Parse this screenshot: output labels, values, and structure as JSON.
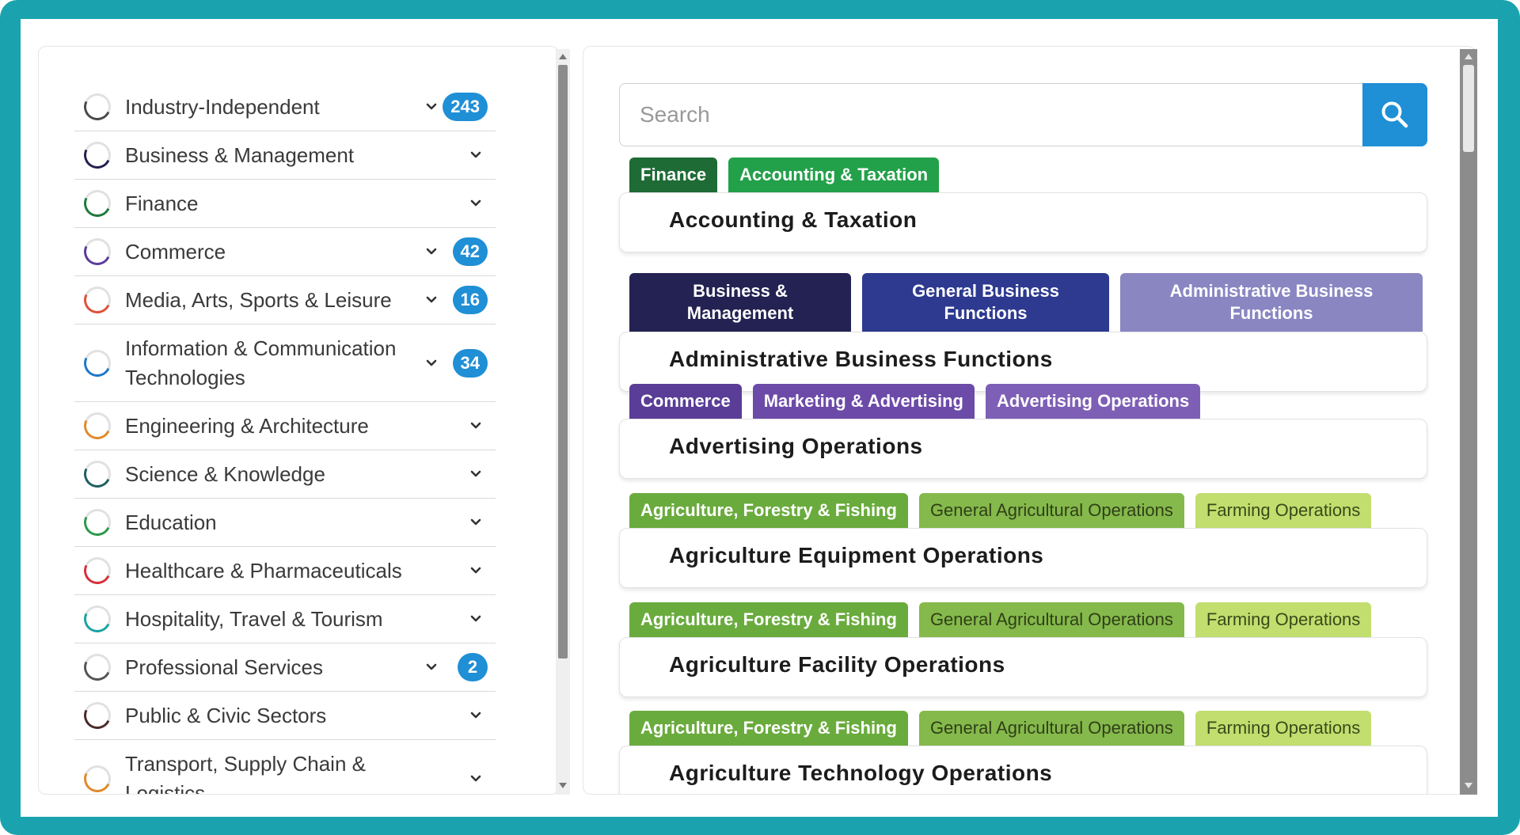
{
  "colors": {
    "frame": "#1aa3ae",
    "accent": "#1f8fd6"
  },
  "categories": [
    {
      "label": "Industry-Independent",
      "count": "243",
      "ring_color": "#4a4a4a"
    },
    {
      "label": "Business & Management",
      "count": null,
      "ring_color": "#23204f"
    },
    {
      "label": "Finance",
      "count": null,
      "ring_color": "#1e7a3c"
    },
    {
      "label": "Commerce",
      "count": "42",
      "ring_color": "#5b3c9a"
    },
    {
      "label": "Media, Arts, Sports & Leisure",
      "count": "16",
      "ring_color": "#e0503a"
    },
    {
      "label": "Information & Communication Technologies",
      "count": "34",
      "ring_color": "#1f78c8"
    },
    {
      "label": "Engineering & Architecture",
      "count": null,
      "ring_color": "#e08a2a"
    },
    {
      "label": "Science & Knowledge",
      "count": null,
      "ring_color": "#1f5f5f"
    },
    {
      "label": "Education",
      "count": null,
      "ring_color": "#2a9a4a"
    },
    {
      "label": "Healthcare & Pharmaceuticals",
      "count": null,
      "ring_color": "#d8303a"
    },
    {
      "label": "Hospitality, Travel & Tourism",
      "count": null,
      "ring_color": "#1aa3a3"
    },
    {
      "label": "Professional Services",
      "count": "2",
      "ring_color": "#555555"
    },
    {
      "label": "Public & Civic Sectors",
      "count": null,
      "ring_color": "#4a2a2a"
    },
    {
      "label": "Transport, Supply Chain & Logistics",
      "count": null,
      "ring_color": "#e08a2a"
    }
  ],
  "search": {
    "placeholder": "Search"
  },
  "results": [
    {
      "title": "Accounting & Taxation",
      "tags": [
        {
          "label": "Finance",
          "color": "#1e6b35"
        },
        {
          "label": "Accounting & Taxation",
          "color": "#23a04a"
        }
      ]
    },
    {
      "title": "Administrative Business Functions",
      "tags": [
        {
          "label": "Business & Management",
          "color": "#232252"
        },
        {
          "label": "General Business Functions",
          "color": "#2d3a8f"
        },
        {
          "label": "Administrative Business Functions",
          "color": "#8a86c2"
        }
      ]
    },
    {
      "title": "Advertising Operations",
      "tags": [
        {
          "label": "Commerce",
          "color": "#5a3d97"
        },
        {
          "label": "Marketing & Advertising",
          "color": "#6c4aa8"
        },
        {
          "label": "Advertising Operations",
          "color": "#7e5fb6"
        }
      ]
    },
    {
      "title": "Agriculture Equipment Operations",
      "tags": [
        {
          "label": "Agriculture, Forestry & Fishing",
          "color": "#6aab3d"
        },
        {
          "label": "General Agricultural Operations",
          "color": "#85b94b"
        },
        {
          "label": "Farming Operations",
          "color": "#c1de6e"
        }
      ]
    },
    {
      "title": "Agriculture Facility Operations",
      "tags": [
        {
          "label": "Agriculture, Forestry & Fishing",
          "color": "#6aab3d"
        },
        {
          "label": "General Agricultural Operations",
          "color": "#85b94b"
        },
        {
          "label": "Farming Operations",
          "color": "#c1de6e"
        }
      ]
    },
    {
      "title": "Agriculture Technology Operations",
      "tags": [
        {
          "label": "Agriculture, Forestry & Fishing",
          "color": "#6aab3d"
        },
        {
          "label": "General Agricultural Operations",
          "color": "#85b94b"
        },
        {
          "label": "Farming Operations",
          "color": "#c1de6e"
        }
      ]
    }
  ]
}
